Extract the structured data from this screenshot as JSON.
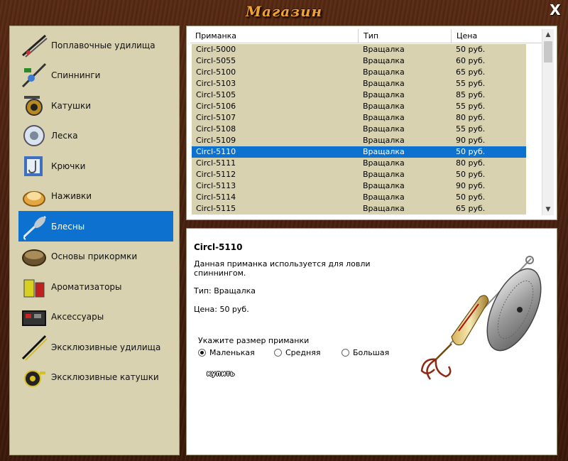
{
  "window": {
    "title": "Магазин",
    "close_label": "X"
  },
  "categories": [
    {
      "label": "Поплавочные удилища",
      "icon": "float-rod-icon"
    },
    {
      "label": "Спиннинги",
      "icon": "spinning-rod-icon"
    },
    {
      "label": "Катушки",
      "icon": "reel-icon"
    },
    {
      "label": "Леска",
      "icon": "fishing-line-icon"
    },
    {
      "label": "Крючки",
      "icon": "hooks-icon"
    },
    {
      "label": "Наживки",
      "icon": "bait-icon"
    },
    {
      "label": "Блесны",
      "icon": "lure-icon",
      "active": true
    },
    {
      "label": "Основы прикормки",
      "icon": "groundbait-icon"
    },
    {
      "label": "Ароматизаторы",
      "icon": "flavor-icon"
    },
    {
      "label": "Аксессуары",
      "icon": "accessories-icon"
    },
    {
      "label": "Эксклюзивные удилища",
      "icon": "exclusive-rod-icon"
    },
    {
      "label": "Эксклюзивные катушки",
      "icon": "exclusive-reel-icon"
    }
  ],
  "table": {
    "headers": [
      "Приманка",
      "Тип",
      "Цена"
    ],
    "rows": [
      [
        "Circl-5000",
        "Вращалка",
        "50 руб."
      ],
      [
        "Circl-5055",
        "Вращалка",
        "60 руб."
      ],
      [
        "Circl-5100",
        "Вращалка",
        "65 руб."
      ],
      [
        "Circl-5103",
        "Вращалка",
        "55 руб."
      ],
      [
        "Circl-5105",
        "Вращалка",
        "85 руб."
      ],
      [
        "Circl-5106",
        "Вращалка",
        "55 руб."
      ],
      [
        "Circl-5107",
        "Вращалка",
        "80 руб."
      ],
      [
        "Circl-5108",
        "Вращалка",
        "55 руб."
      ],
      [
        "Circl-5109",
        "Вращалка",
        "90 руб."
      ],
      [
        "Circl-5110",
        "Вращалка",
        "50 руб."
      ],
      [
        "Circl-5111",
        "Вращалка",
        "80 руб."
      ],
      [
        "Circl-5112",
        "Вращалка",
        "50 руб."
      ],
      [
        "Circl-5113",
        "Вращалка",
        "90 руб."
      ],
      [
        "Circl-5114",
        "Вращалка",
        "50 руб."
      ],
      [
        "Circl-5115",
        "Вращалка",
        "65 руб."
      ]
    ],
    "selected_index": 9
  },
  "detail": {
    "name": "Circl-5110",
    "description": "Данная приманка используется для ловли спиннингом.",
    "type_line": "Тип: Вращалка",
    "price_line": "Цена: 50 руб.",
    "size_prompt": "Укажите размер приманки",
    "sizes": [
      "Маленькая",
      "Средняя",
      "Большая"
    ],
    "selected_size": 0,
    "buy_label": "купить"
  },
  "colors": {
    "accent": "#0c71cf",
    "panel": "#d8d2b1",
    "title": "#f0a330"
  }
}
